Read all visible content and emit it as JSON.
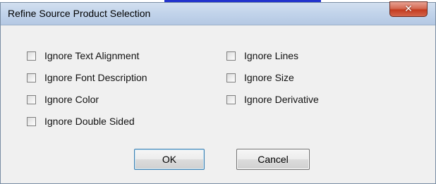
{
  "window": {
    "title": "Refine Source Product Selection",
    "close_glyph": "✕"
  },
  "options": {
    "left": [
      {
        "label": "Ignore Text Alignment",
        "checked": false
      },
      {
        "label": "Ignore Font Description",
        "checked": false
      },
      {
        "label": "Ignore Color",
        "checked": false
      },
      {
        "label": "Ignore Double Sided",
        "checked": false
      }
    ],
    "right": [
      {
        "label": "Ignore Lines",
        "checked": false
      },
      {
        "label": "Ignore Size",
        "checked": false
      },
      {
        "label": "Ignore Derivative",
        "checked": false
      }
    ]
  },
  "buttons": {
    "ok_label": "OK",
    "cancel_label": "Cancel"
  },
  "colors": {
    "close_button": "#c43c20",
    "background_link": "#2233cc"
  }
}
